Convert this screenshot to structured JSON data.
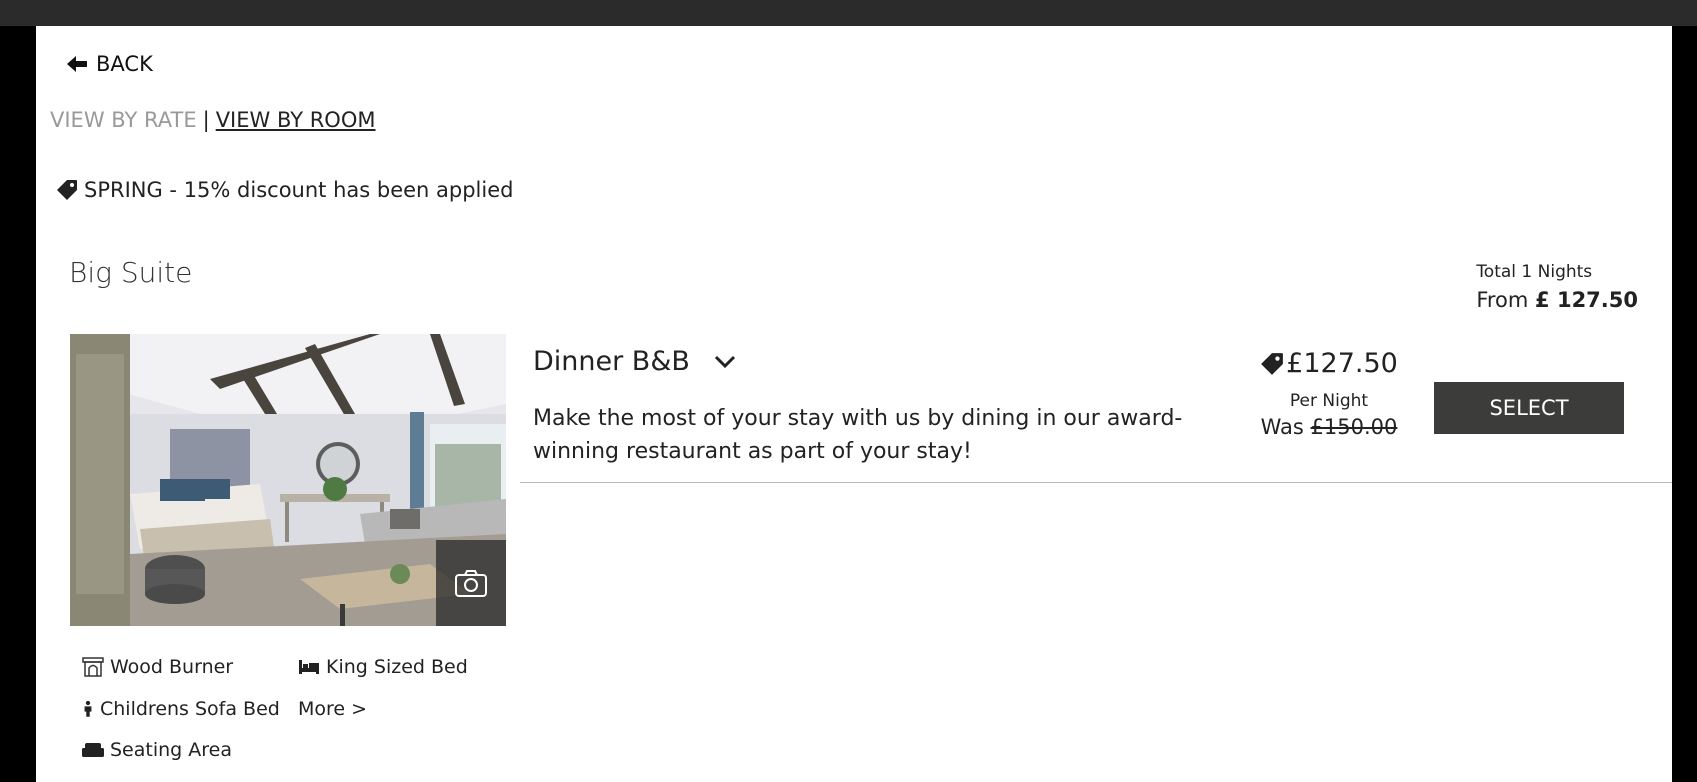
{
  "nav": {
    "back_label": "BACK",
    "view_by_rate": "VIEW BY RATE",
    "separator": "|",
    "view_by_room": "VIEW BY ROOM"
  },
  "discount": {
    "text": "SPRING - 15% discount has been applied",
    "icon": "tag-icon"
  },
  "room": {
    "title": "Big Suite",
    "total_label": "Total 1 Nights",
    "from_prefix": "From",
    "from_price": "£ 127.50",
    "amenities": [
      {
        "label": "Wood Burner",
        "icon": "fireplace-icon"
      },
      {
        "label": "King Sized Bed",
        "icon": "bed-icon"
      },
      {
        "label": "Childrens Sofa Bed",
        "icon": "child-icon"
      },
      {
        "label": "More >",
        "icon": ""
      },
      {
        "label": "Seating Area",
        "icon": "sofa-icon"
      }
    ]
  },
  "rate": {
    "name": "Dinner B&B",
    "description": "Make the most of your stay with us by dining in our award-winning restaurant as part of your stay!",
    "price": "£127.50",
    "per_night": "Per Night",
    "was_prefix": "Was",
    "was_price": "£150.00",
    "select_label": "SELECT"
  },
  "colors": {
    "button_bg": "#3c3c3b",
    "muted_link": "#999999",
    "frame": "#000000"
  }
}
